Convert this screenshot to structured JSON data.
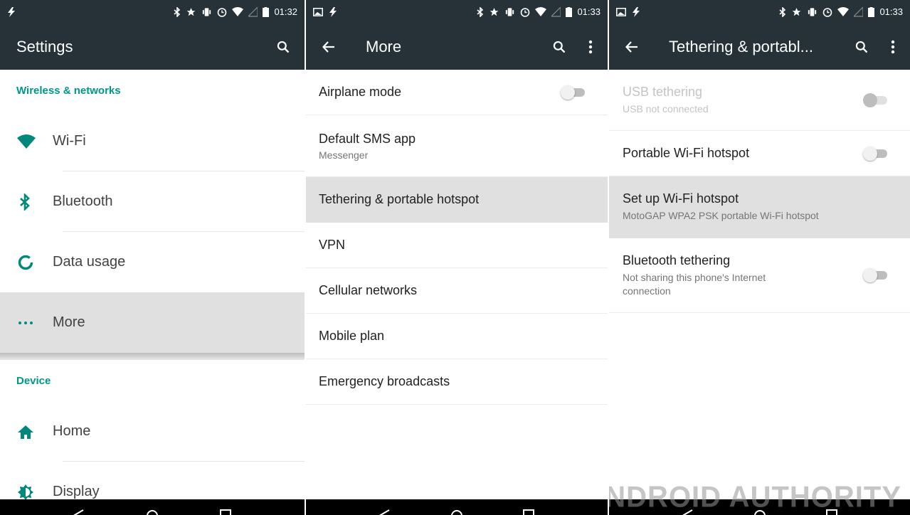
{
  "colors": {
    "bar": "#263238",
    "accent": "#009688",
    "selected": "#e0e0e0"
  },
  "panels": [
    {
      "status": {
        "time": "01:32"
      },
      "toolbar": {
        "title": "Settings",
        "actions": [
          "search-icon"
        ]
      },
      "sections": [
        {
          "header": "Wireless & networks",
          "items": [
            {
              "label": "Wi-Fi",
              "icon": "wifi-icon"
            },
            {
              "label": "Bluetooth",
              "icon": "bluetooth-icon"
            },
            {
              "label": "Data usage",
              "icon": "data-usage-icon"
            },
            {
              "label": "More",
              "icon": "more-dots-icon",
              "selected": true
            }
          ]
        },
        {
          "header": "Device",
          "items": [
            {
              "label": "Home",
              "icon": "home-icon"
            },
            {
              "label": "Display",
              "icon": "display-brightness-icon"
            }
          ]
        }
      ]
    },
    {
      "status": {
        "time": "01:33"
      },
      "toolbar": {
        "title": "More",
        "actions": [
          "back-arrow-icon",
          "search-icon",
          "overflow-menu-icon"
        ]
      },
      "items": [
        {
          "title": "Airplane mode",
          "switch": "off"
        },
        {
          "title": "Default SMS app",
          "subtitle": "Messenger"
        },
        {
          "title": "Tethering & portable hotspot",
          "selected": true
        },
        {
          "title": "VPN"
        },
        {
          "title": "Cellular networks"
        },
        {
          "title": "Mobile plan"
        },
        {
          "title": "Emergency broadcasts"
        }
      ]
    },
    {
      "status": {
        "time": "01:33"
      },
      "toolbar": {
        "title": "Tethering & portabl...",
        "actions": [
          "back-arrow-icon",
          "search-icon",
          "overflow-menu-icon"
        ]
      },
      "items": [
        {
          "title": "USB tethering",
          "subtitle": "USB not connected",
          "switch": "disabled"
        },
        {
          "title": "Portable Wi-Fi hotspot",
          "switch": "off"
        },
        {
          "title": "Set up Wi-Fi hotspot",
          "subtitle": "MotoGAP WPA2 PSK portable Wi-Fi hotspot",
          "selected": true
        },
        {
          "title": "Bluetooth tethering",
          "subtitle": "Not sharing this phone's Internet connection",
          "switch": "off"
        }
      ]
    }
  ],
  "watermark": "ANDROID AUTHORITY"
}
